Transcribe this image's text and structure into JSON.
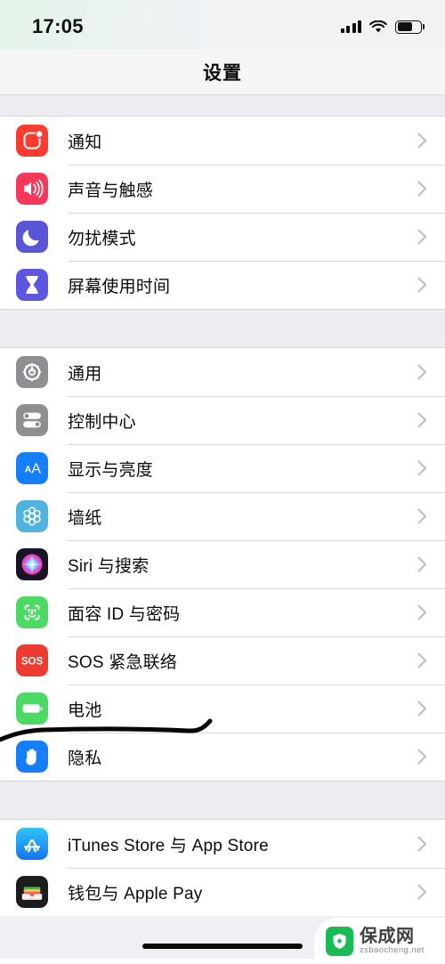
{
  "status_bar": {
    "time": "17:05",
    "signal_icon": "cellular-bars-icon",
    "signal_bars": 4,
    "wifi_icon": "wifi-icon",
    "battery_icon": "battery-icon",
    "battery_level_percent": 65
  },
  "nav": {
    "title": "设置"
  },
  "groups": [
    {
      "id": "notifications-group",
      "rows": [
        {
          "label": "通知",
          "icon": "notifications-icon",
          "color": "#ff3b30"
        },
        {
          "label": "声音与触感",
          "icon": "sounds-haptics-icon",
          "color": "#f6395a"
        },
        {
          "label": "勿扰模式",
          "icon": "do-not-disturb-icon",
          "color": "#5856d6"
        },
        {
          "label": "屏幕使用时间",
          "icon": "screen-time-icon",
          "color": "#5c56e0"
        }
      ]
    },
    {
      "id": "general-group",
      "rows": [
        {
          "label": "通用",
          "icon": "general-gear-icon",
          "color": "#8e8e93"
        },
        {
          "label": "控制中心",
          "icon": "control-center-icon",
          "color": "#8e8e93"
        },
        {
          "label": "显示与亮度",
          "icon": "display-brightness-icon",
          "color": "#157efb"
        },
        {
          "label": "墙纸",
          "icon": "wallpaper-icon",
          "color": "#4fb3e0"
        },
        {
          "label": "Siri 与搜索",
          "icon": "siri-icon",
          "color": "#1b1b2e"
        },
        {
          "label": "面容 ID 与密码",
          "icon": "face-id-icon",
          "color": "#4cd964"
        },
        {
          "label": "SOS 紧急联络",
          "icon": "emergency-sos-icon",
          "color": "#ee3b32"
        },
        {
          "label": "电池",
          "icon": "battery-settings-icon",
          "color": "#4cd964"
        },
        {
          "label": "隐私",
          "icon": "privacy-hand-icon",
          "color": "#157efb"
        }
      ]
    },
    {
      "id": "stores-group",
      "rows": [
        {
          "label": "iTunes Store 与 App Store",
          "icon": "app-store-icon",
          "color": "#2196f3"
        },
        {
          "label": "钱包与 Apple Pay",
          "icon": "wallet-icon",
          "color": "#1c1c1e"
        }
      ]
    }
  ],
  "annotation": {
    "name": "handdrawn-underline",
    "target_row_label": "电池",
    "color": "#050505"
  },
  "watermark": {
    "logo_icon": "shield-logo-icon",
    "name": "保成网",
    "url": "zsbaocheng.net",
    "brand_color": "#19bb56"
  },
  "home_indicator": {
    "name": "home-indicator"
  },
  "chevron_icon": "chevron-right-icon"
}
